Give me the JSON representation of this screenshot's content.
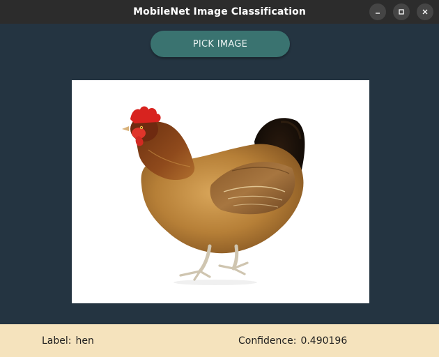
{
  "window": {
    "title": "MobileNet Image Classification",
    "controls": [
      "minimize-icon",
      "maximize-icon",
      "close-icon"
    ]
  },
  "main": {
    "pick_button_label": "PICK IMAGE",
    "image_subject": "hen"
  },
  "footer": {
    "label_caption": "Label:",
    "label_value": "hen",
    "confidence_caption": "Confidence:",
    "confidence_value": "0.490196"
  },
  "colors": {
    "background": "#243441",
    "titlebar": "#2c2c2c",
    "button": "#3a7370",
    "footer": "#f5e3bd"
  }
}
